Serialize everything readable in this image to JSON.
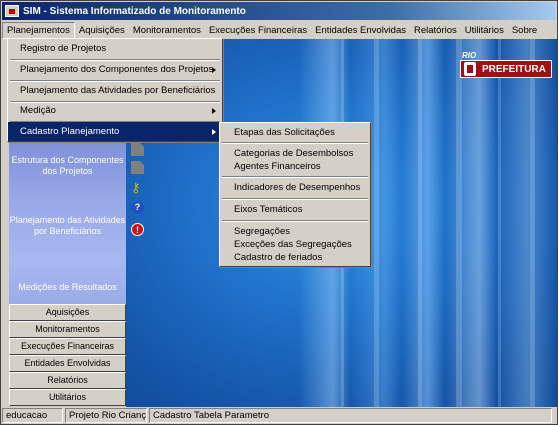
{
  "window": {
    "title": "SIM - Sistema Informatizado de Monitoramento"
  },
  "menubar": {
    "items": [
      "Planejamentos",
      "Aquisições",
      "Monitoramentos",
      "Execuções Financeiras",
      "Entidades Envolvidas",
      "Relatórios",
      "Utilitários",
      "Sobre"
    ]
  },
  "planejamentos_menu": {
    "items": [
      {
        "label": "Registro de Projetos"
      },
      {
        "label": "Planejamento dos Componentes dos Projetos"
      },
      {
        "label": "Planejamento das Atividades por Beneficiários"
      },
      {
        "label": "Medição"
      },
      {
        "label": "Cadastro Planejamento"
      }
    ]
  },
  "cadastro_submenu": {
    "items": [
      {
        "label": "Etapas das Solicitações"
      },
      {
        "label": "Categorias de Desembolsos"
      },
      {
        "label": "Agentes Financeiros"
      },
      {
        "label": "Indicadores de Desempenhos"
      },
      {
        "label": "Eixos Temáticos"
      },
      {
        "label": "Segregações"
      },
      {
        "label": "Exceções das Segregações"
      },
      {
        "label": "Cadastro de feriados"
      }
    ]
  },
  "sidebar": {
    "panel_items": [
      "Estrutura dos Componentes dos Projetos",
      "Planejamento das Atividades por Beneficiários",
      "Medições de Resultados"
    ],
    "buttons": [
      "Aquisições",
      "Monitoramentos",
      "Execuções Financeiras",
      "Entidades Envolvidas",
      "Relatórios",
      "Utilitários"
    ]
  },
  "logo": {
    "top_text": "RIO",
    "main_text": "PREFEITURA"
  },
  "statusbar": {
    "user": "educacao",
    "project": "Projeto Rio Criança",
    "screen": "Cadastro Tabela Parametro"
  },
  "colors": {
    "titlebar": "#0a246a",
    "highlight": "#0a246a",
    "desktop": "#1e6fc8",
    "logo": "#a01010"
  }
}
